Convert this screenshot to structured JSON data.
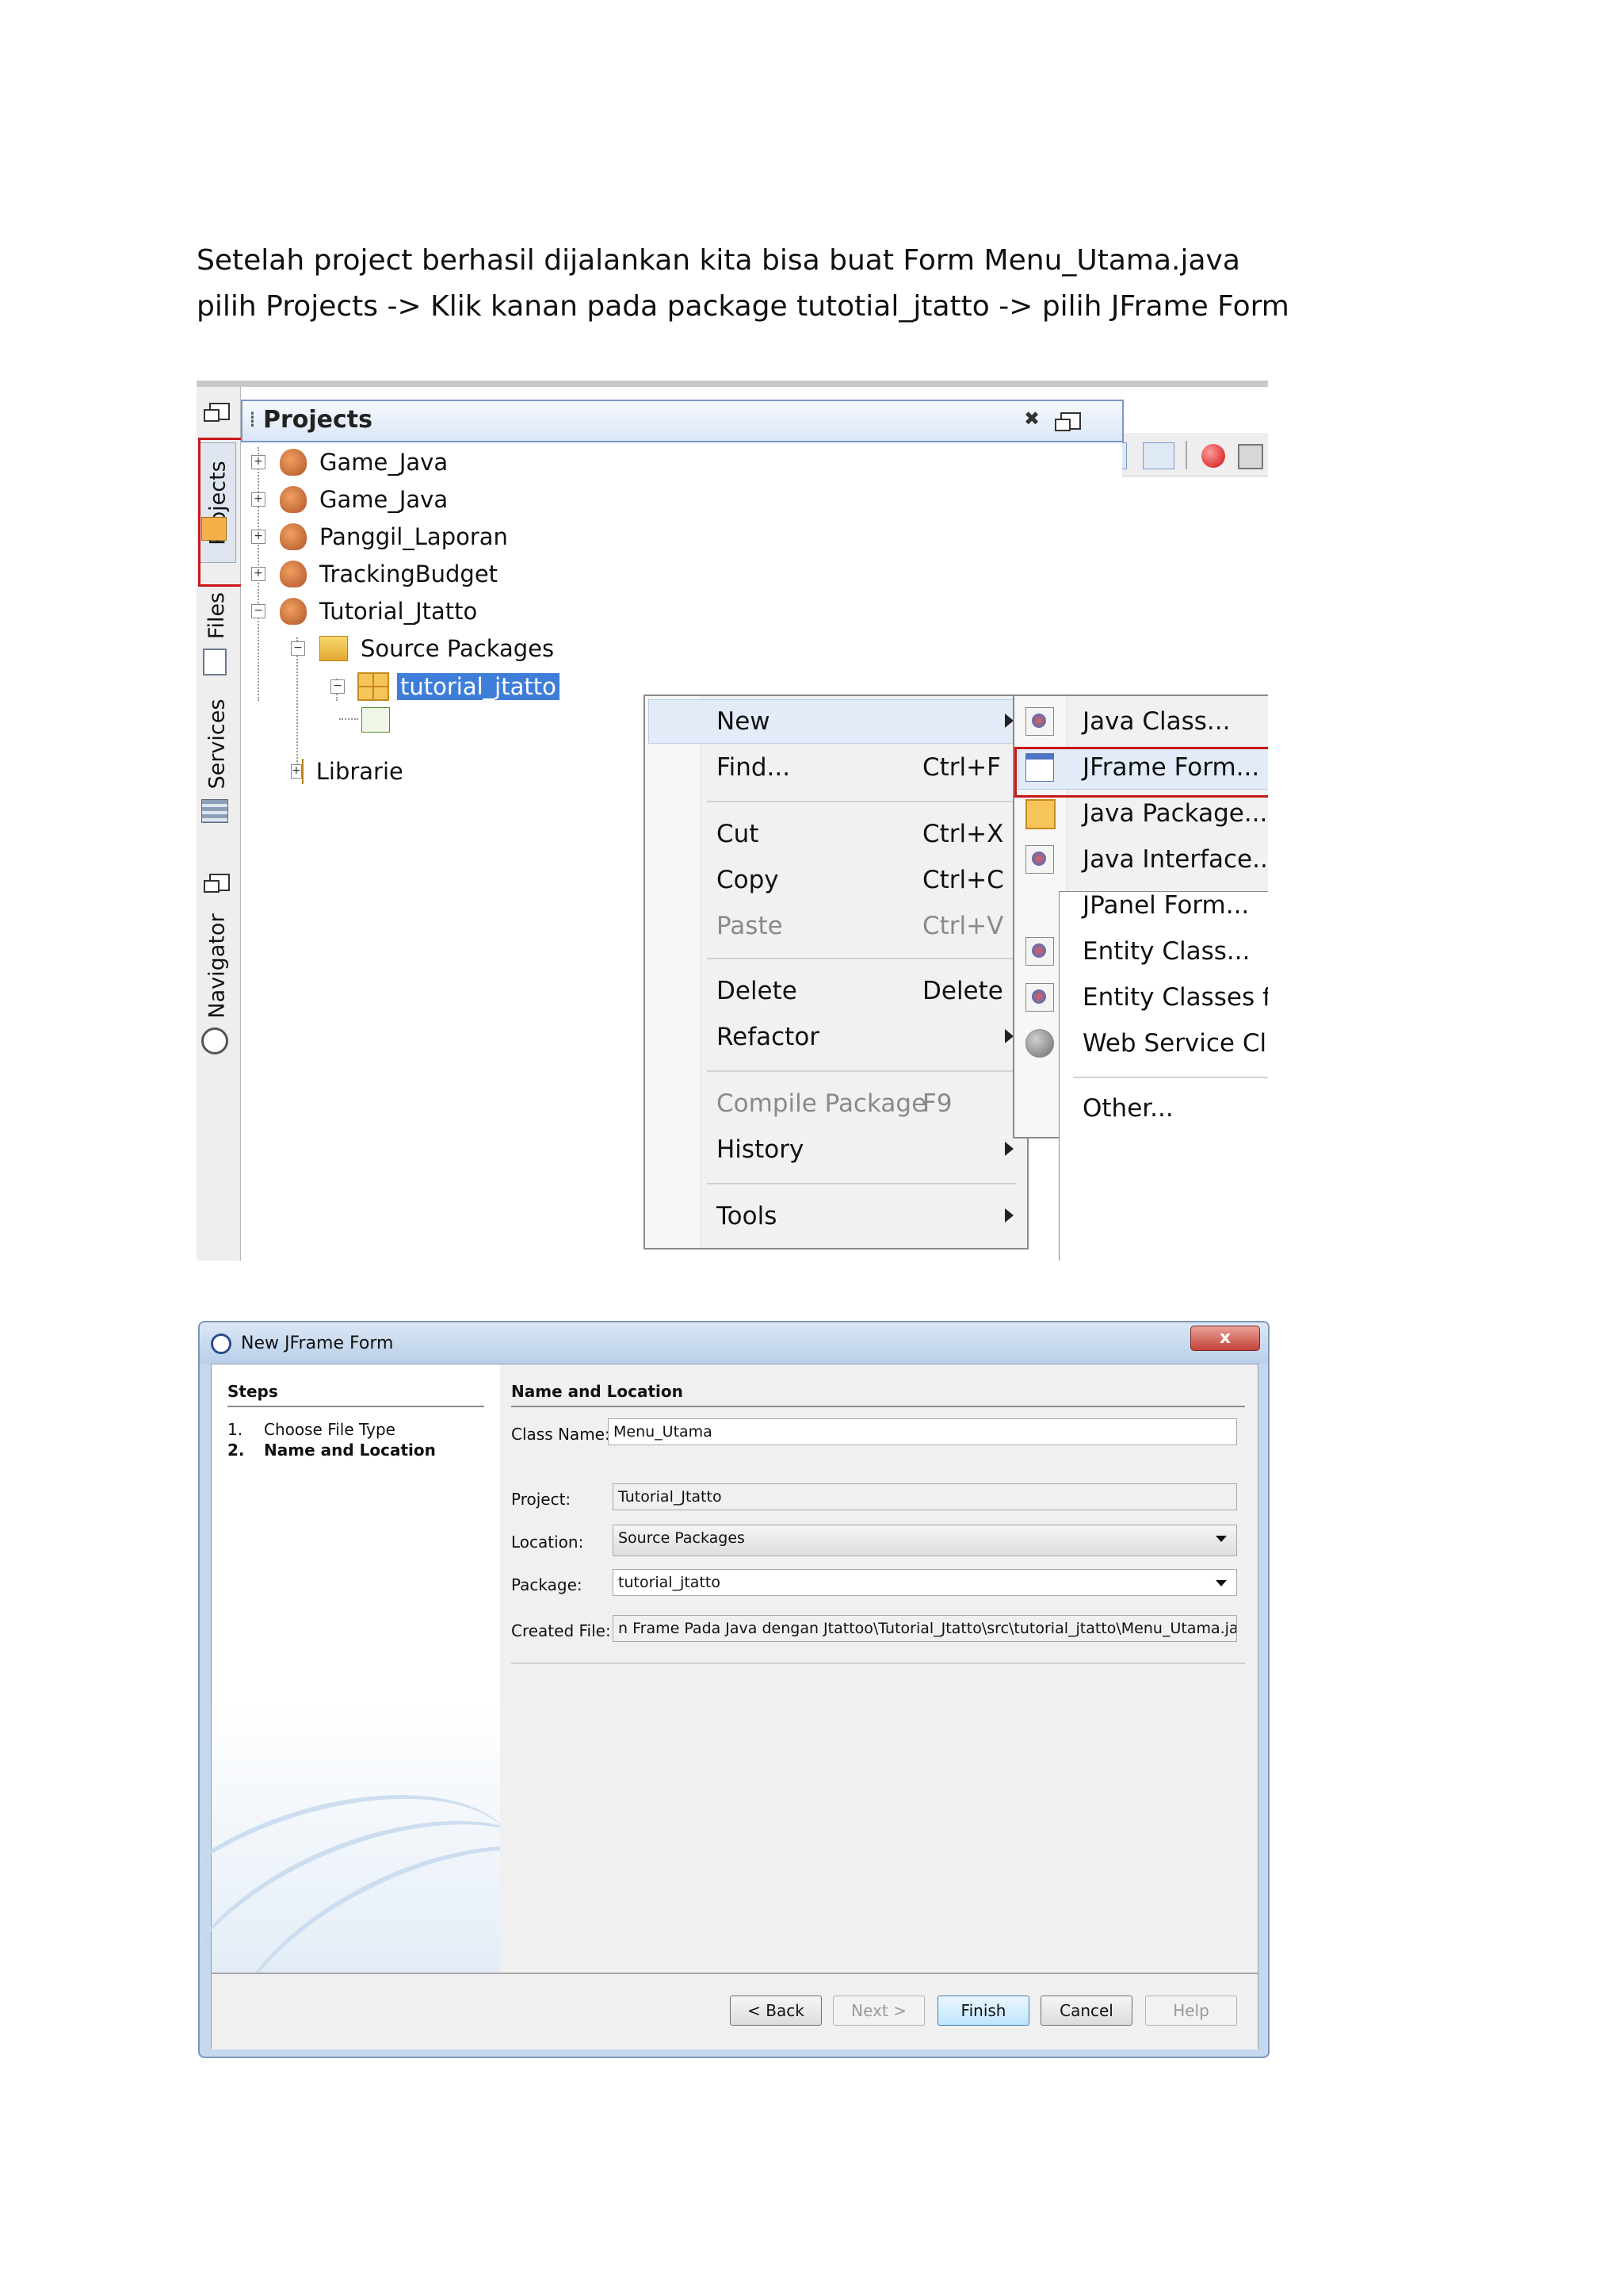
{
  "intro": {
    "line1": "Setelah project berhasil dijalankan kita bisa buat Form Menu_Utama.java",
    "line2": "pilih Projects -> Klik kanan pada package tutotial_jtatto -> pilih JFrame Form"
  },
  "netbeans": {
    "sidebar_tabs": [
      "Projects",
      "Files",
      "Services",
      "Navigator"
    ],
    "panel_title": "Projects",
    "tree": [
      {
        "label": "Game_Java",
        "expander": "+"
      },
      {
        "label": "Game_Java",
        "expander": "+"
      },
      {
        "label": "Panggil_Laporan",
        "expander": "+"
      },
      {
        "label": "TrackingBudget",
        "expander": "+"
      },
      {
        "label": "Tutorial_Jtatto",
        "expander": "−"
      },
      {
        "label": "Source Packages",
        "expander": "−"
      },
      {
        "label": "tutorial_jtatto",
        "expander": "−"
      },
      {
        "label": "Libraries",
        "expander": "+"
      }
    ],
    "context_menu": [
      {
        "label": "New",
        "shortcut": "",
        "submenu": true,
        "disabled": false
      },
      {
        "label": "Find...",
        "shortcut": "Ctrl+F",
        "submenu": false,
        "disabled": false
      },
      {
        "label": "Cut",
        "shortcut": "Ctrl+X",
        "submenu": false,
        "disabled": false
      },
      {
        "label": "Copy",
        "shortcut": "Ctrl+C",
        "submenu": false,
        "disabled": false
      },
      {
        "label": "Paste",
        "shortcut": "Ctrl+V",
        "submenu": false,
        "disabled": true
      },
      {
        "label": "Delete",
        "shortcut": "Delete",
        "submenu": false,
        "disabled": false
      },
      {
        "label": "Refactor",
        "shortcut": "",
        "submenu": true,
        "disabled": false
      },
      {
        "label": "Compile Package",
        "shortcut": "F9",
        "submenu": false,
        "disabled": true
      },
      {
        "label": "History",
        "shortcut": "",
        "submenu": true,
        "disabled": false
      },
      {
        "label": "Tools",
        "shortcut": "",
        "submenu": true,
        "disabled": false
      }
    ],
    "new_submenu": [
      {
        "label": "Java Class...",
        "icon": "java-class-icon"
      },
      {
        "label": "JFrame Form...",
        "icon": "jframe-form-icon",
        "highlighted": true
      },
      {
        "label": "Java Package...",
        "icon": "java-package-icon"
      },
      {
        "label": "Java Interface...",
        "icon": "java-interface-icon"
      },
      {
        "label": "JPanel Form...",
        "icon": "jpanel-form-icon"
      },
      {
        "label": "Entity Class...",
        "icon": "entity-class-icon"
      },
      {
        "label": "Entity Classes from Database...",
        "icon": "entity-classes-db-icon"
      },
      {
        "label": "Web Service Client...",
        "icon": "web-service-client-icon"
      },
      {
        "label": "Other...",
        "icon": ""
      }
    ],
    "highlight_color": "#c81818",
    "selection_color": "#3f7ed8"
  },
  "dialog": {
    "title": "New JFrame Form",
    "close_label": "x",
    "steps_heading": "Steps",
    "steps": [
      {
        "num": "1.",
        "label": "Choose File Type",
        "current": false
      },
      {
        "num": "2.",
        "label": "Name and Location",
        "current": true
      }
    ],
    "section_heading": "Name and Location",
    "fields": {
      "class_name_label": "Class Name:",
      "class_name_value": "Menu_Utama",
      "project_label": "Project:",
      "project_value": "Tutorial_Jtatto",
      "location_label": "Location:",
      "location_value": "Source Packages",
      "package_label": "Package:",
      "package_value": "tutorial_jtatto",
      "created_file_label": "Created File:",
      "created_file_value": "n Frame Pada Java dengan Jtattoo\\Tutorial_Jtatto\\src\\tutorial_jtatto\\Menu_Utama.java"
    },
    "buttons": {
      "back": "< Back",
      "next": "Next >",
      "finish": "Finish",
      "cancel": "Cancel",
      "help": "Help"
    }
  }
}
